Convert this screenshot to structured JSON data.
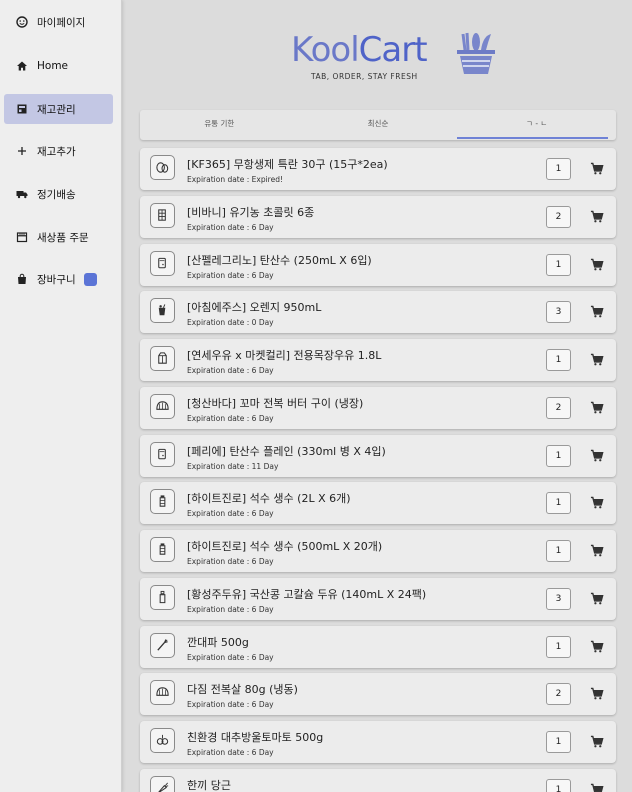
{
  "sidebar": {
    "items": [
      {
        "label": "마이페이지",
        "icon": "smiley-face-icon"
      },
      {
        "label": "Home",
        "icon": "home-icon"
      },
      {
        "label": "재고관리",
        "icon": "inventory-icon",
        "active": true
      },
      {
        "label": "재고추가",
        "icon": "plus-icon"
      },
      {
        "label": "정기배송",
        "icon": "truck-icon"
      },
      {
        "label": "새상품 주문",
        "icon": "storefront-icon"
      },
      {
        "label": "장바구니",
        "icon": "shopping-bag-icon",
        "badge_color": "#5b74d6"
      }
    ]
  },
  "logo": {
    "text_kool": "Kool",
    "text_cart": "Cart",
    "tagline": "TAB, ORDER, STAY FRESH"
  },
  "tabs": [
    "유통 기한",
    "최신순",
    "ㄱ - ㄴ"
  ],
  "active_tab": 2,
  "accent_color": "#6f82d6",
  "items": [
    {
      "name": "[KF365] 무항생제 특란 30구 (15구*2ea)",
      "expiration": "Expiration date : Expired!",
      "qty": "1",
      "icon": "eggs-icon"
    },
    {
      "name": "[비바니] 유기농 초콜릿 6종",
      "expiration": "Expiration date : 6 Day",
      "qty": "2",
      "icon": "chocolate-icon"
    },
    {
      "name": "[산펠레그리노] 탄산수 (250mL X 6입)",
      "expiration": "Expiration date : 6 Day",
      "qty": "1",
      "icon": "soda-can-icon"
    },
    {
      "name": "[아침에주스] 오렌지 950mL",
      "expiration": "Expiration date : 0 Day",
      "qty": "3",
      "icon": "juice-cup-icon"
    },
    {
      "name": "[연세우유 x 마켓컬리] 전용목장우유 1.8L",
      "expiration": "Expiration date : 6 Day",
      "qty": "1",
      "icon": "milk-carton-icon"
    },
    {
      "name": "[청산바다] 꼬마 전복 버터 구이 (냉장)",
      "expiration": "Expiration date : 6 Day",
      "qty": "2",
      "icon": "shell-icon"
    },
    {
      "name": "[페리에] 탄산수 플레인 (330ml 병 X 4입)",
      "expiration": "Expiration date : 11 Day",
      "qty": "1",
      "icon": "soda-can-icon"
    },
    {
      "name": "[하이트진로] 석수 생수 (2L X 6개)",
      "expiration": "Expiration date : 6 Day",
      "qty": "1",
      "icon": "water-bottle-icon"
    },
    {
      "name": "[하이트진로] 석수 생수 (500mL X 20개)",
      "expiration": "Expiration date : 6 Day",
      "qty": "1",
      "icon": "water-bottle-icon"
    },
    {
      "name": "[황성주두유] 국산콩 고칼슘 두유 (140mL X 24팩)",
      "expiration": "Expiration date : 6 Day",
      "qty": "3",
      "icon": "bottle-icon"
    },
    {
      "name": "깐대파 500g",
      "expiration": "Expiration date : 6 Day",
      "qty": "1",
      "icon": "green-onion-icon"
    },
    {
      "name": "다짐 전복살 80g (냉동)",
      "expiration": "Expiration date : 6 Day",
      "qty": "2",
      "icon": "shell-icon"
    },
    {
      "name": "친환경 대추방울토마토 500g",
      "expiration": "Expiration date : 6 Day",
      "qty": "1",
      "icon": "tomato-icon"
    },
    {
      "name": "한끼 당근",
      "expiration": "",
      "qty": "1",
      "icon": "carrot-icon"
    }
  ]
}
